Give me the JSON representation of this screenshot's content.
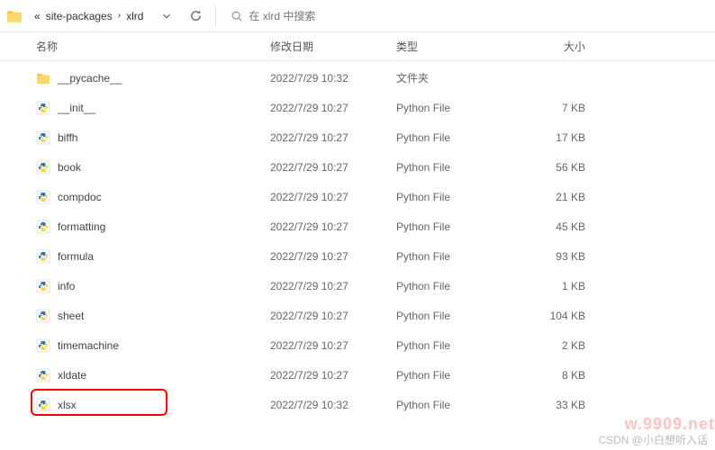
{
  "breadcrumb": {
    "prefix": "«",
    "parent": "site-packages",
    "current": "xlrd"
  },
  "search": {
    "placeholder": "在 xlrd 中搜索"
  },
  "columns": {
    "name": "名称",
    "date": "修改日期",
    "type": "类型",
    "size": "大小"
  },
  "files": [
    {
      "name": "__pycache__",
      "date": "2022/7/29 10:32",
      "type": "文件夹",
      "size": "",
      "icon": "folder",
      "highlighted": false
    },
    {
      "name": "__init__",
      "date": "2022/7/29 10:27",
      "type": "Python File",
      "size": "7 KB",
      "icon": "python",
      "highlighted": false
    },
    {
      "name": "biffh",
      "date": "2022/7/29 10:27",
      "type": "Python File",
      "size": "17 KB",
      "icon": "python",
      "highlighted": false
    },
    {
      "name": "book",
      "date": "2022/7/29 10:27",
      "type": "Python File",
      "size": "56 KB",
      "icon": "python",
      "highlighted": false
    },
    {
      "name": "compdoc",
      "date": "2022/7/29 10:27",
      "type": "Python File",
      "size": "21 KB",
      "icon": "python",
      "highlighted": false
    },
    {
      "name": "formatting",
      "date": "2022/7/29 10:27",
      "type": "Python File",
      "size": "45 KB",
      "icon": "python",
      "highlighted": false
    },
    {
      "name": "formula",
      "date": "2022/7/29 10:27",
      "type": "Python File",
      "size": "93 KB",
      "icon": "python",
      "highlighted": false
    },
    {
      "name": "info",
      "date": "2022/7/29 10:27",
      "type": "Python File",
      "size": "1 KB",
      "icon": "python",
      "highlighted": false
    },
    {
      "name": "sheet",
      "date": "2022/7/29 10:27",
      "type": "Python File",
      "size": "104 KB",
      "icon": "python",
      "highlighted": false
    },
    {
      "name": "timemachine",
      "date": "2022/7/29 10:27",
      "type": "Python File",
      "size": "2 KB",
      "icon": "python",
      "highlighted": false
    },
    {
      "name": "xldate",
      "date": "2022/7/29 10:27",
      "type": "Python File",
      "size": "8 KB",
      "icon": "python",
      "highlighted": false
    },
    {
      "name": "xlsx",
      "date": "2022/7/29 10:32",
      "type": "Python File",
      "size": "33 KB",
      "icon": "python",
      "highlighted": true
    }
  ],
  "watermark1": "CSDN @小白想听入话",
  "watermark2": "w.9909.net"
}
